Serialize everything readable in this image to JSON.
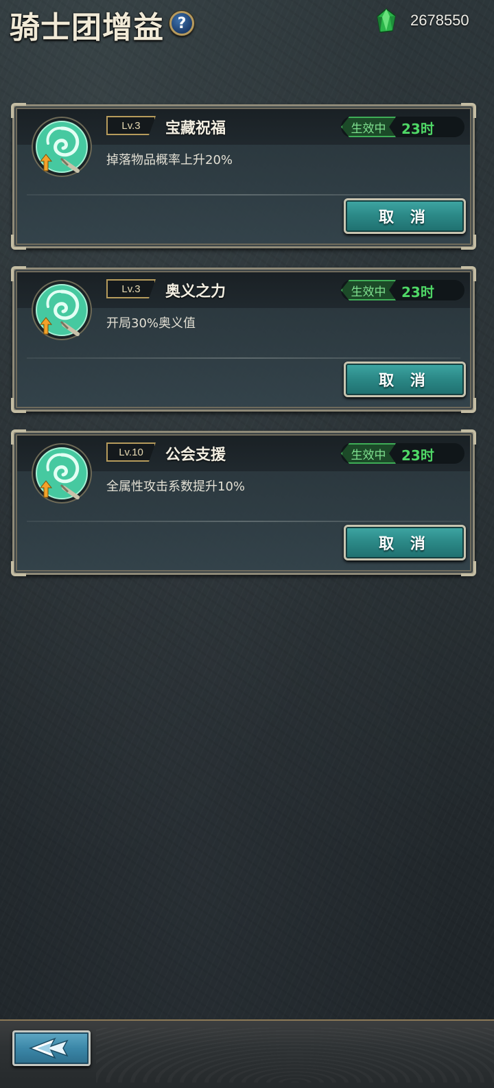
{
  "header": {
    "title": "骑士团增益",
    "help_label": "?",
    "currency_icon": "green-gem-icon",
    "currency_value": "2678550"
  },
  "buffs": [
    {
      "icon": "guild-buff-swirl-icon",
      "level": "Lv.3",
      "name": "宝藏祝福",
      "status": "生效中",
      "duration": "23时",
      "description": "掉落物品概率上升20%",
      "cancel_label": "取 消"
    },
    {
      "icon": "guild-buff-swirl-icon",
      "level": "Lv.3",
      "name": "奥义之力",
      "status": "生效中",
      "duration": "23时",
      "description": "开局30%奥义值",
      "cancel_label": "取 消"
    },
    {
      "icon": "guild-buff-swirl-icon",
      "level": "Lv.10",
      "name": "公会支援",
      "status": "生效中",
      "duration": "23时",
      "description": "全属性攻击系数提升10%",
      "cancel_label": "取 消"
    }
  ],
  "footer": {
    "back_icon": "back-arrow-icon"
  },
  "colors": {
    "accent_gold": "#b79c5c",
    "status_green": "#4fd766",
    "button_teal": "#2c8a88",
    "back_blue": "#3b87a8"
  }
}
